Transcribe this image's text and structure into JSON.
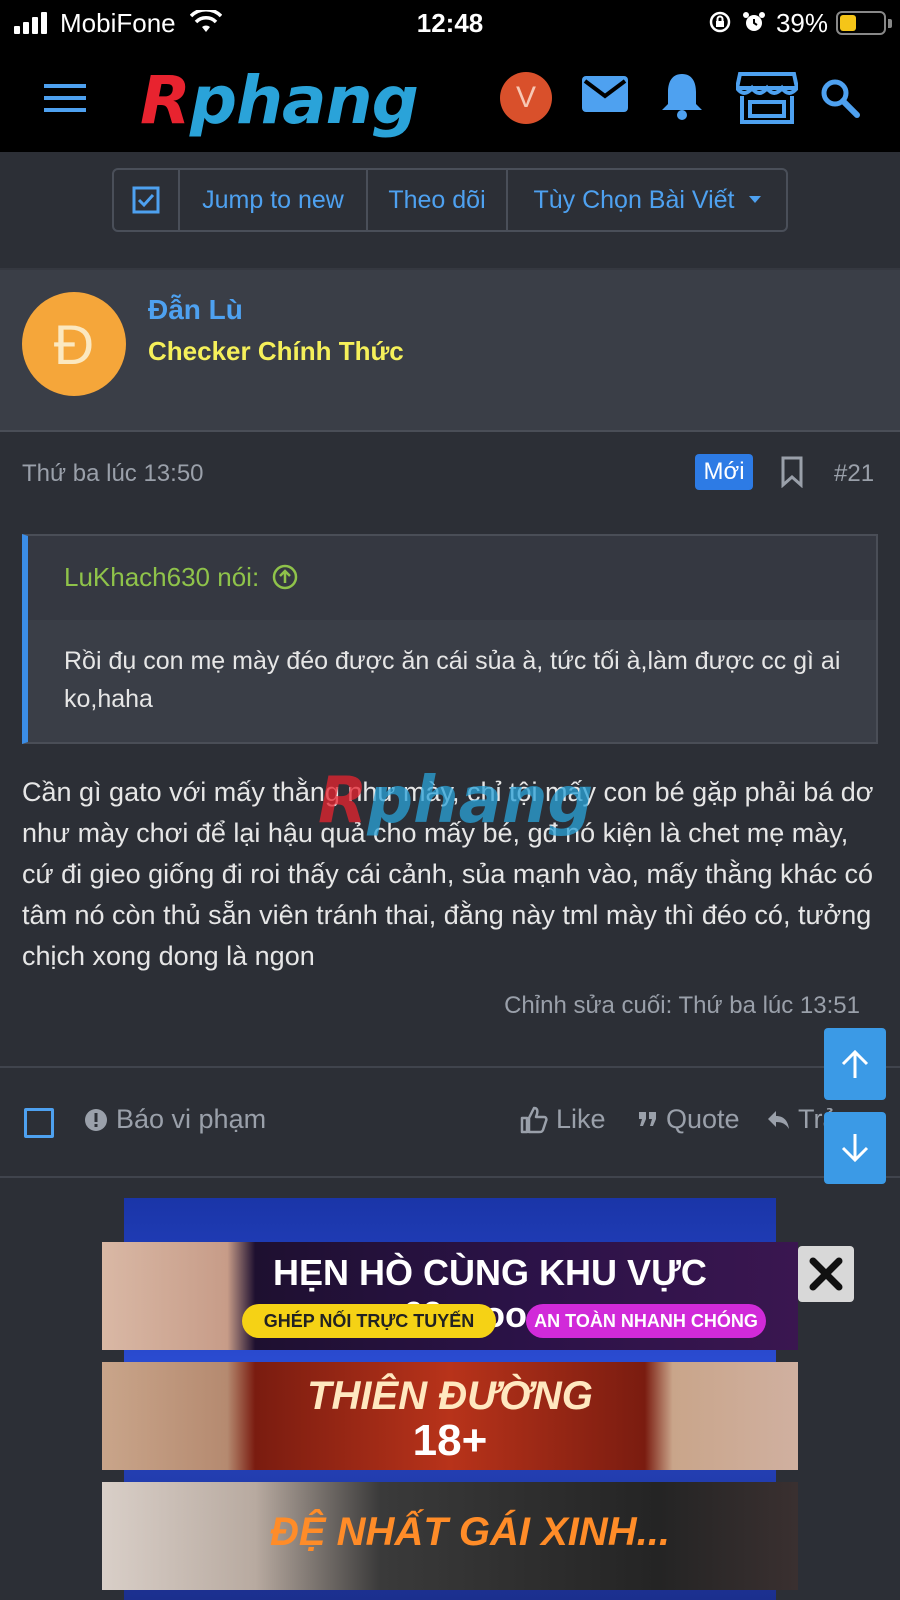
{
  "status_bar": {
    "carrier": "MobiFone",
    "time": "12:48",
    "battery_percent": "39%"
  },
  "header": {
    "logo_r": "R",
    "logo_rest": "phang",
    "user_initial": "V"
  },
  "toolbar": {
    "jump_label": "Jump to new",
    "follow_label": "Theo dõi",
    "options_label": "Tùy Chọn Bài Viết"
  },
  "author": {
    "avatar_letter": "Đ",
    "name": "Đẫn Lù",
    "title": "Checker Chính Thức"
  },
  "post": {
    "date": "Thứ ba lúc 13:50",
    "new_badge": "Mới",
    "number": "#21",
    "quote_author": "LuKhach630 nói:",
    "quote_text": "Rồi đụ con mẹ mày đéo được ăn cái sủa à, tức tối à,làm được cc gì ai ko,haha",
    "body": "Cần gì gato với mấy thằng như mày, chỉ tội mấy con bé gặp phải bá dơ như mày chơi để lại hậu quả cho mấy bé, gđ nó kiện là chet mẹ mày, cứ đi gieo giống đi roi thấy cái cảnh, sủa mạnh vào, mấy thằng khác có tâm nó còn thủ sẵn viên tránh thai, đằng này tml mày thì đéo có, tưởng chịch xong dong là ngon",
    "edited": "Chỉnh sửa cuối: Thứ ba lúc 13:51"
  },
  "actions": {
    "report": "Báo vi phạm",
    "like": "Like",
    "quote": "Quote",
    "reply": "Trả"
  },
  "ads": {
    "ad1_title": "HẸN HÒ CÙNG KHU VỰC 69xxoo.cc",
    "ad1_pill1": "GHÉP NỐI TRỰC TUYẾN",
    "ad1_pill2": "AN TOÀN NHANH CHÓNG",
    "ad2_title": "THIÊN ĐƯỜNG",
    "ad2_sub": "18+",
    "ad3_title": "ĐỆ NHẤT GÁI XINH..."
  },
  "colors": {
    "accent": "#4ea1f0",
    "background": "#2c2f36",
    "author_title": "#f5f05a",
    "quote_author": "#8fc34a"
  }
}
